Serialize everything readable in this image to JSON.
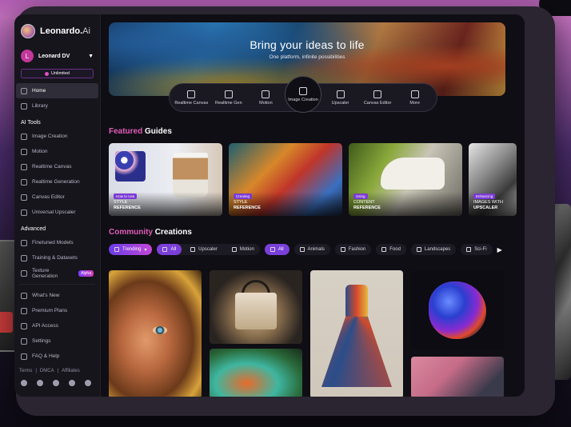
{
  "app": {
    "brand": "Leonardo.",
    "brand_suffix": "Ai"
  },
  "user": {
    "avatar_initial": "L",
    "name": "Leonard DV",
    "plan": "Unlimited"
  },
  "sidebar": {
    "primary": [
      {
        "label": "Home",
        "icon": "home-icon",
        "active": true
      },
      {
        "label": "Library",
        "icon": "library-icon",
        "active": false
      }
    ],
    "ai_tools_title": "AI Tools",
    "ai_tools": [
      {
        "label": "Image Creation",
        "icon": "image-icon"
      },
      {
        "label": "Motion",
        "icon": "motion-icon"
      },
      {
        "label": "Realtime Canvas",
        "icon": "brush-icon"
      },
      {
        "label": "Realtime Generation",
        "icon": "bolt-icon"
      },
      {
        "label": "Canvas Editor",
        "icon": "canvas-icon"
      },
      {
        "label": "Universal Upscaler",
        "icon": "upscale-icon"
      }
    ],
    "advanced_title": "Advanced",
    "advanced": [
      {
        "label": "Finetuned Models",
        "icon": "model-icon"
      },
      {
        "label": "Training & Datasets",
        "icon": "dataset-icon"
      },
      {
        "label": "Texture Generation",
        "icon": "texture-icon",
        "badge": "Alpha"
      }
    ],
    "secondary": [
      {
        "label": "What's New",
        "icon": "news-icon"
      },
      {
        "label": "Premium Plans",
        "icon": "crown-icon"
      },
      {
        "label": "API Access",
        "icon": "api-icon"
      },
      {
        "label": "Settings",
        "icon": "gear-icon"
      },
      {
        "label": "FAQ & Help",
        "icon": "help-icon"
      }
    ],
    "footer_links": [
      "Terms",
      "DMCA",
      "Affiliates"
    ],
    "socials": [
      "discord-icon",
      "reddit-icon",
      "x-icon",
      "facebook-icon",
      "instagram-icon"
    ]
  },
  "hero": {
    "title": "Bring your ideas to life",
    "subtitle": "One platform, infinite possibilities"
  },
  "tools": [
    {
      "label": "Realtime Canvas",
      "icon": "brush-icon"
    },
    {
      "label": "Realtime Gen",
      "icon": "grid-icon"
    },
    {
      "label": "Motion",
      "icon": "motion-icon"
    },
    {
      "label": "Image Creation",
      "icon": "image-icon",
      "active": true
    },
    {
      "label": "Upscaler",
      "icon": "upscale-icon"
    },
    {
      "label": "Canvas Editor",
      "icon": "canvas-icon"
    },
    {
      "label": "More",
      "icon": "sparkle-icon"
    }
  ],
  "featured": {
    "title_accent": "Featured",
    "title_rest": " Guides",
    "guides": [
      {
        "tag": "How to Use",
        "line1": "STYLE",
        "line2": "REFERENCE"
      },
      {
        "tag": "Creating",
        "line1": "STYLE",
        "line2": "REFERENCE"
      },
      {
        "tag": "Using",
        "line1": "CONTENT",
        "line2": "REFERENCE"
      },
      {
        "tag": "Enhancing",
        "line1": "IMAGES WITH",
        "line2": "UPSCALER"
      }
    ]
  },
  "community": {
    "title_accent": "Community",
    "title_rest": " Creations",
    "trending": "Trending",
    "media_filters": [
      "All",
      "Upscaler",
      "Motion"
    ],
    "category_filters": [
      "All",
      "Animals",
      "Fashion",
      "Food",
      "Landscapes",
      "Sci-Fi"
    ]
  }
}
